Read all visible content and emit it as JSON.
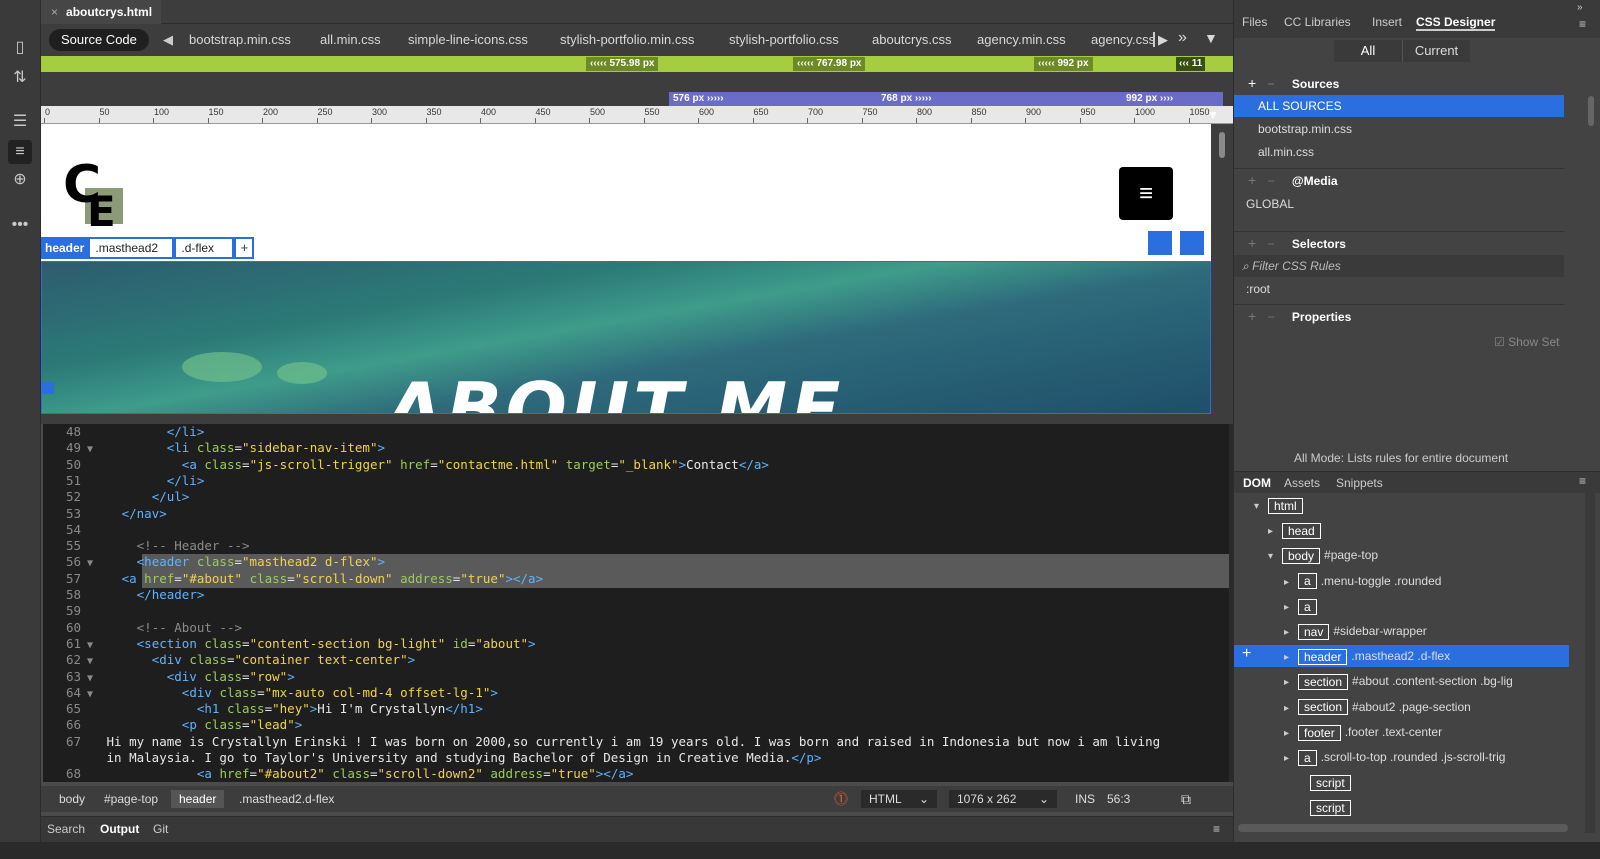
{
  "document": {
    "tab_title": "aboutcrys.html",
    "close": "×"
  },
  "related_files": {
    "source_code": "Source Code",
    "files": [
      "bootstrap.min.css",
      "all.min.css",
      "simple-line-icons.css",
      "stylish-portfolio.min.css",
      "stylish-portfolio.css",
      "aboutcrys.css",
      "agency.min.css",
      "agency.css"
    ]
  },
  "media_queries": {
    "green": [
      "575.98",
      "767.98",
      "992",
      "11"
    ],
    "green_unit": "px",
    "purple": [
      "576",
      "768",
      "992"
    ],
    "purple_unit": "px"
  },
  "ruler": [
    "0",
    "50",
    "100",
    "150",
    "200",
    "250",
    "300",
    "350",
    "400",
    "450",
    "500",
    "550",
    "600",
    "650",
    "700",
    "750",
    "800",
    "850",
    "900",
    "950",
    "1000",
    "1050"
  ],
  "live_view": {
    "logo_text": "CE",
    "menu_icon": "≡",
    "hero_text": "ABOUT ME",
    "element_display": {
      "tag": "header",
      "class1": ".masthead2",
      "class2": ".d-flex",
      "add": "+"
    }
  },
  "code": [
    {
      "n": "48",
      "f": "",
      "html": "        <span class='tg'>&lt;/li&gt;</span>"
    },
    {
      "n": "49",
      "f": "▼",
      "html": "        <span class='tg'>&lt;li</span> <span class='at'>class</span>=<span class='vl'>\"sidebar-nav-item\"</span><span class='tg'>&gt;</span>"
    },
    {
      "n": "50",
      "f": "",
      "html": "          <span class='tg'>&lt;a</span> <span class='at'>class</span>=<span class='vl'>\"js-scroll-trigger\"</span> <span class='at'>href</span>=<span class='vl'>\"contactme.html\"</span> <span class='at'>target</span>=<span class='vl'>\"_blank\"</span><span class='tg'>&gt;</span>Contact<span class='tg'>&lt;/a&gt;</span>"
    },
    {
      "n": "51",
      "f": "",
      "html": "        <span class='tg'>&lt;/li&gt;</span>"
    },
    {
      "n": "52",
      "f": "",
      "html": "      <span class='tg'>&lt;/ul&gt;</span>"
    },
    {
      "n": "53",
      "f": "",
      "html": "  <span class='tg'>&lt;/nav&gt;</span>"
    },
    {
      "n": "54",
      "f": "",
      "html": ""
    },
    {
      "n": "55",
      "f": "",
      "html": "    <span class='cm'>&lt;!-- Header --&gt;</span>"
    },
    {
      "n": "56",
      "f": "▼",
      "html": "    <span class='tg'>&lt;header</span> <span class='at'>class</span>=<span class='vl'>\"masthead2 d-flex\"</span><span class='tg'>&gt;</span>"
    },
    {
      "n": "57",
      "f": "",
      "html": "  <span class='tg'>&lt;a</span> <span class='at'>href</span>=<span class='vl'>\"#about\"</span> <span class='at'>class</span>=<span class='vl'>\"scroll-down\"</span> <span class='at'>address</span>=<span class='vl'>\"true\"</span><span class='tg'>&gt;&lt;/a&gt;</span>"
    },
    {
      "n": "58",
      "f": "",
      "html": "    <span class='tg'>&lt;/header&gt;</span>"
    },
    {
      "n": "59",
      "f": "",
      "html": ""
    },
    {
      "n": "60",
      "f": "",
      "html": "    <span class='cm'>&lt;!-- About --&gt;</span>"
    },
    {
      "n": "61",
      "f": "▼",
      "html": "    <span class='tg'>&lt;section</span> <span class='at'>class</span>=<span class='vl'>\"content-section bg-light\"</span> <span class='at'>id</span>=<span class='vl'>\"about\"</span><span class='tg'>&gt;</span>"
    },
    {
      "n": "62",
      "f": "▼",
      "html": "      <span class='tg'>&lt;div</span> <span class='at'>class</span>=<span class='vl'>\"container text-center\"</span><span class='tg'>&gt;</span>"
    },
    {
      "n": "63",
      "f": "▼",
      "html": "        <span class='tg'>&lt;div</span> <span class='at'>class</span>=<span class='vl'>\"row\"</span><span class='tg'>&gt;</span>"
    },
    {
      "n": "64",
      "f": "▼",
      "html": "          <span class='tg'>&lt;div</span> <span class='at'>class</span>=<span class='vl'>\"mx-auto col-md-4 offset-lg-1\"</span><span class='tg'>&gt;</span>"
    },
    {
      "n": "65",
      "f": "",
      "html": "            <span class='tg'>&lt;h1</span> <span class='at'>class</span>=<span class='vl'>\"hey\"</span><span class='tg'>&gt;</span>Hi I'm Crystallyn<span class='tg'>&lt;/h1&gt;</span>"
    },
    {
      "n": "66",
      "f": "",
      "html": "          <span class='tg'>&lt;p</span> <span class='at'>class</span>=<span class='vl'>\"lead\"</span><span class='tg'>&gt;</span>"
    },
    {
      "n": "67",
      "f": "",
      "html": "Hi my name is Crystallyn Erinski ! I was born on 2000,so currently i am 19 years old. I was born and raised in Indonesia but now i am living"
    },
    {
      "n": "",
      "f": "",
      "html": "in Malaysia. I go to Taylor's University and studying Bachelor of Design in Creative Media.<span class='tg'>&lt;/p&gt;</span>"
    },
    {
      "n": "68",
      "f": "",
      "html": "            <span class='tg'>&lt;a</span> <span class='at'>href</span>=<span class='vl'>\"#about2\"</span> <span class='at'>class</span>=<span class='vl'>\"scroll-down2\"</span> <span class='at'>address</span>=<span class='vl'>\"true\"</span><span class='tg'>&gt;&lt;/a&gt;</span>"
    }
  ],
  "status_bar": {
    "crumbs": [
      "body",
      "#page-top",
      "header",
      ".masthead2.d-flex"
    ],
    "doc_type": "HTML",
    "window_size": "1076 x 262",
    "mode": "INS",
    "cursor": "56:3"
  },
  "bottom_tabs": [
    "Search",
    "Output",
    "Git"
  ],
  "right_panel": {
    "tabs": [
      "Files",
      "CC Libraries",
      "Insert",
      "CSS Designer"
    ],
    "mode_buttons": [
      "All",
      "Current"
    ],
    "sources_title": "Sources",
    "sources": [
      "ALL SOURCES",
      "bootstrap.min.css",
      "all.min.css"
    ],
    "media_title": "@Media",
    "media_global": "GLOBAL",
    "selectors_title": "Selectors",
    "filter_placeholder": "Filter CSS Rules",
    "selector_item": ":root",
    "properties_title": "Properties",
    "show_set": "Show Set",
    "all_mode_note": "All Mode: Lists rules for entire document"
  },
  "dom_panel": {
    "tabs": [
      "DOM",
      "Assets",
      "Snippets"
    ],
    "rows": [
      {
        "tag": "html",
        "text": ""
      },
      {
        "tag": "head",
        "text": ""
      },
      {
        "tag": "body",
        "text": "#page-top"
      },
      {
        "tag": "a",
        "text": ".menu-toggle .rounded"
      },
      {
        "tag": "a",
        "text": ""
      },
      {
        "tag": "nav",
        "text": "#sidebar-wrapper"
      },
      {
        "tag": "header",
        "text": ".masthead2 .d-flex"
      },
      {
        "tag": "section",
        "text": "#about .content-section .bg-lig"
      },
      {
        "tag": "section",
        "text": "#about2 .page-section"
      },
      {
        "tag": "footer",
        "text": ".footer .text-center"
      },
      {
        "tag": "a",
        "text": ".scroll-to-top .rounded .js-scroll-trig"
      },
      {
        "tag": "script",
        "text": ""
      },
      {
        "tag": "script",
        "text": ""
      }
    ]
  }
}
